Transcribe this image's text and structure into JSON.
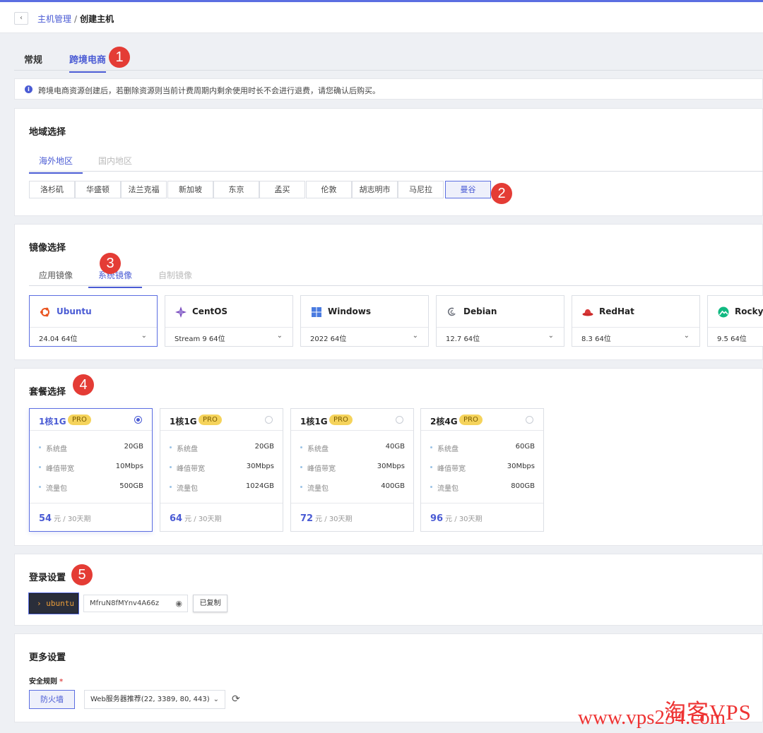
{
  "breadcrumb": {
    "back": "‹",
    "parent": "主机管理",
    "separator": "/",
    "current": "创建主机"
  },
  "main_tabs": [
    {
      "label": "常规"
    },
    {
      "label": "跨境电商"
    }
  ],
  "notice": {
    "icon": "info-icon",
    "text": "跨境电商资源创建后，若删除资源则当前计费周期内剩余使用时长不会进行退费，请您确认后购买。"
  },
  "region": {
    "title": "地域选择",
    "tabs": [
      {
        "label": "海外地区"
      },
      {
        "label": "国内地区"
      }
    ],
    "cities": [
      "洛杉矶",
      "华盛顿",
      "法兰克福",
      "新加坡",
      "东京",
      "孟买",
      "伦敦",
      "胡志明市",
      "马尼拉",
      "曼谷"
    ],
    "selected": "曼谷"
  },
  "image": {
    "title": "镜像选择",
    "tabs": [
      {
        "label": "应用镜像"
      },
      {
        "label": "系统镜像"
      },
      {
        "label": "自制镜像"
      }
    ],
    "os": [
      {
        "name": "Ubuntu",
        "version": "24.04 64位",
        "icon": "ubuntu-icon"
      },
      {
        "name": "CentOS",
        "version": "Stream 9 64位",
        "icon": "centos-icon"
      },
      {
        "name": "Windows",
        "version": "2022 64位",
        "icon": "windows-icon"
      },
      {
        "name": "Debian",
        "version": "12.7 64位",
        "icon": "debian-icon"
      },
      {
        "name": "RedHat",
        "version": "8.3 64位",
        "icon": "redhat-icon"
      },
      {
        "name": "Rocky",
        "version": "9.5 64位",
        "icon": "rocky-icon"
      }
    ],
    "chevron": "⌄"
  },
  "package": {
    "title": "套餐选择",
    "pro": "PRO",
    "unit": "元 / 30天期",
    "plans": [
      {
        "name": "1核1G",
        "disk": "20GB",
        "bandwidth": "10Mbps",
        "traffic": "500GB",
        "price": "54"
      },
      {
        "name": "1核1G",
        "disk": "20GB",
        "bandwidth": "30Mbps",
        "traffic": "1024GB",
        "price": "64"
      },
      {
        "name": "1核1G",
        "disk": "40GB",
        "bandwidth": "30Mbps",
        "traffic": "400GB",
        "price": "72"
      },
      {
        "name": "2核4G",
        "disk": "60GB",
        "bandwidth": "30Mbps",
        "traffic": "800GB",
        "price": "96"
      }
    ],
    "labels": {
      "disk": "系统盘",
      "bandwidth": "峰值带宽",
      "traffic": "流量包"
    }
  },
  "login": {
    "title": "登录设置",
    "user": "› ubuntu",
    "password": "MfruN8fMYnv4A66z",
    "copied": "已复制"
  },
  "more": {
    "title": "更多设置",
    "rule_label": "安全规则",
    "required": "*",
    "firewall": "防火墙",
    "rule_value": "Web服务器推荐(22, 3389, 80, 443)",
    "chevron": "⌄",
    "refresh": "⟳"
  },
  "annotations": [
    "1",
    "2",
    "3",
    "4",
    "5"
  ],
  "watermark": {
    "line1": "淘客VPS",
    "line2": "www.vps234.com"
  },
  "colors": {
    "accent": "#4a5bd4",
    "pro_badge": "#f5d35b",
    "annotation": "#e43c35",
    "watermark": "#ee3333"
  }
}
